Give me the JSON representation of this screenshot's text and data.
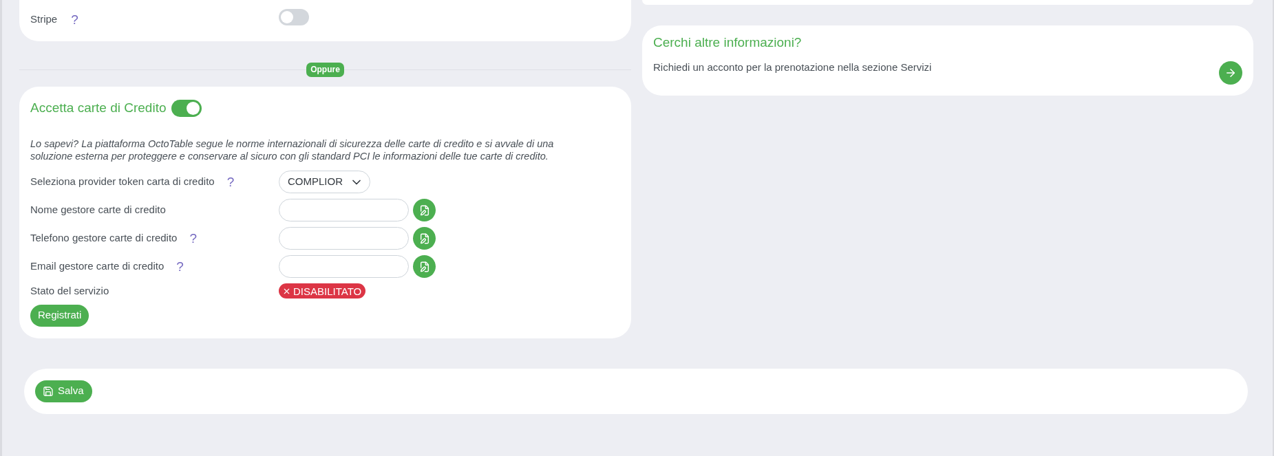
{
  "stripe_card": {
    "label": "Stripe",
    "help": "?",
    "toggle": {
      "on": false
    }
  },
  "separator": {
    "label": "Oppure"
  },
  "credit_card_section": {
    "title": "Accetta carte di Credito",
    "toggle": {
      "on": true
    },
    "notice": "Lo sapevi? La piattaforma OctoTable segue le norme internazionali di sicurezza delle carte di credito e si avvale di una soluzione esterna per proteggere e conservare al sicuro con gli standard PCI le informazioni delle tue carte di credito.",
    "fields": [
      {
        "kind": "select",
        "label": "Seleziona provider token carta di credito",
        "help": "?",
        "value": "COMPLIOR"
      },
      {
        "kind": "input",
        "label": "Nome gestore carte di credito"
      },
      {
        "kind": "input",
        "label": "Telefono gestore carte di credito",
        "help": "?"
      },
      {
        "kind": "input",
        "label": "Email gestore carte di credito",
        "help": "?"
      },
      {
        "kind": "status",
        "label": "Stato del servizio",
        "badge": {
          "text": "DISABILITATO",
          "enabled": false
        }
      }
    ],
    "register_button": {
      "label": "Registrati"
    }
  },
  "info_card": {
    "title": "Cerchi altre informazioni?",
    "text": "Richiedi un acconto per la prenotazione nella sezione Servizi"
  },
  "save_bar": {
    "save_button": {
      "label": "Salva"
    }
  }
}
